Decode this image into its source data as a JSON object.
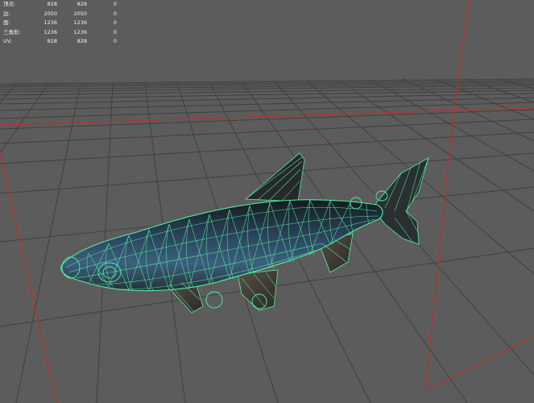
{
  "hud": {
    "rows": [
      {
        "label": "顶点:",
        "values": [
          "828",
          "828",
          "0"
        ]
      },
      {
        "label": "边:",
        "values": [
          "2050",
          "2050",
          "0"
        ]
      },
      {
        "label": "面:",
        "values": [
          "1236",
          "1236",
          "0"
        ]
      },
      {
        "label": "三角形:",
        "values": [
          "1236",
          "1236",
          "0"
        ]
      },
      {
        "label": "UV:",
        "values": [
          "828",
          "828",
          "0"
        ]
      }
    ]
  },
  "colors": {
    "background": "#5c5c5c",
    "grid_line": "#3f3f3f",
    "axis_line": "#b8322f",
    "wireframe": "#54f0a0",
    "fish_body_dark": "#1b2328",
    "fish_body_blue": "#3a5d79",
    "hud_text": "#f2f2f2"
  }
}
